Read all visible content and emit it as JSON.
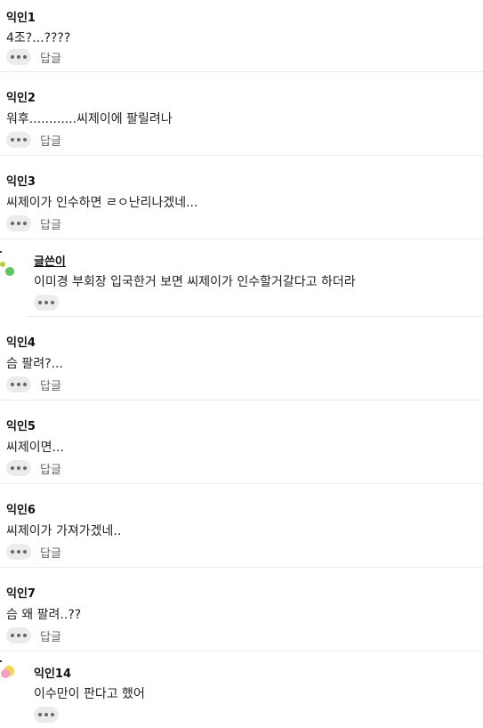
{
  "comments": [
    {
      "name": "익인1",
      "text": "4조?...????",
      "reply_label": "답글"
    },
    {
      "name": "익인2",
      "text": "워후............씨제이에 팔릴려나",
      "reply_label": "답글"
    },
    {
      "name": "익인3",
      "text": "씨제이가 인수하면 ㄹㅇ난리나겠네...",
      "reply_label": "답글"
    },
    {
      "name": "글쓴이",
      "text": "이미경 부회장 입국한거 보면 씨제이가 인수할거갈다고 하더라",
      "is_reply": true,
      "is_author": true
    },
    {
      "name": "익인4",
      "text": "슴 팔려?...",
      "reply_label": "답글"
    },
    {
      "name": "익인5",
      "text": "씨제이면...",
      "reply_label": "답글"
    },
    {
      "name": "익인6",
      "text": "씨제이가 가져가겠네..",
      "reply_label": "답글"
    },
    {
      "name": "익인7",
      "text": "슴 왜 팔려..??",
      "reply_label": "답글"
    },
    {
      "name": "익인14",
      "text": "이수만이 판다고 했어",
      "is_reply": true
    }
  ],
  "icons": {
    "more": "more-dots-icon",
    "avatar": "anonymous-avatar-icon"
  },
  "colors": {
    "button_bg": "#ebebeb",
    "divider": "#ececec",
    "reply_text": "#666666",
    "avatar_green": "#5cc463",
    "avatar_pink": "#f2a3c4",
    "avatar_yellow": "#f7d154"
  }
}
